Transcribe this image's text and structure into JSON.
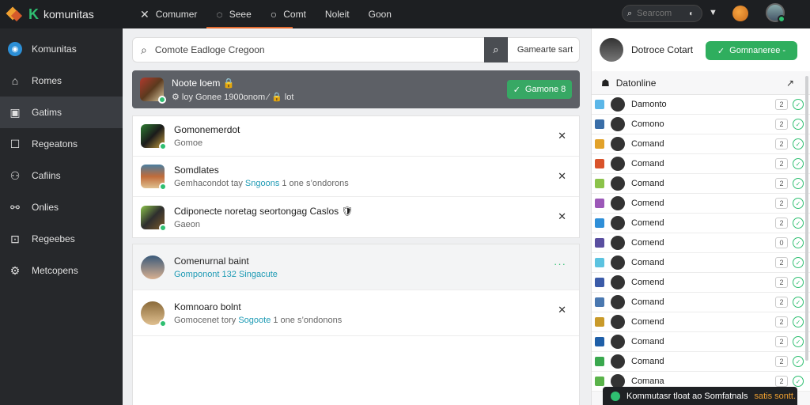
{
  "brand": {
    "name": "komunitas",
    "logo_letter": "K"
  },
  "topnav": [
    {
      "icon": "✕",
      "label": "Comumer"
    },
    {
      "icon": "◌",
      "label": "Seee"
    },
    {
      "icon": "○",
      "label": "Comt"
    },
    {
      "icon": "",
      "label": "Noleit"
    },
    {
      "icon": "",
      "label": "Goon"
    }
  ],
  "top_search": {
    "placeholder": "Searcom"
  },
  "sidebar": [
    {
      "label": "Komunitas",
      "icon": "◉"
    },
    {
      "label": "Romes",
      "icon": "⌂"
    },
    {
      "label": "Gatims",
      "icon": "▣"
    },
    {
      "label": "Regeatons",
      "icon": "☐"
    },
    {
      "label": "Cafiins",
      "icon": "⚇"
    },
    {
      "label": "Onlies",
      "icon": "⚯"
    },
    {
      "label": "Regeebes",
      "icon": "⊡"
    },
    {
      "label": "Metcopens",
      "icon": "⚙"
    }
  ],
  "main": {
    "search": {
      "value": "Comote Eadloge Cregoon",
      "extra": "Gamearte sart"
    },
    "feature": {
      "title": "Noote loem 🔒",
      "sub": "⚙ loy Gonee 1900onom ⁄ 🔒 lot",
      "button": "Gamone 8"
    },
    "rows": [
      {
        "title": "Gomonemerdot",
        "sub": "Gomoe",
        "accent": "",
        "after": ""
      },
      {
        "title": "Somdlates",
        "sub": "Gemhacondot tay ",
        "accent": "Sngoons",
        "after": " 1 one s’ondorons"
      },
      {
        "title": "Cdiponecte noretag seortongag Caslos 🛡",
        "sub": "Gaeon",
        "accent": "",
        "after": ""
      }
    ],
    "rows2": [
      {
        "title": "Comenurnal baint",
        "sub": "",
        "accent": "Gomponont 132 Singacute",
        "after": ""
      },
      {
        "title": "Komnoaro bolnt",
        "sub": "Gomocenet tory ",
        "accent": "Sogoote",
        "after": " 1 one s’ondonons"
      }
    ],
    "more_icon": "···"
  },
  "right": {
    "user_name": "Dotroce Cotart",
    "button": "Gomnaneree -",
    "online_title": "Datonline",
    "users": [
      {
        "name": "Damonto",
        "count": "2",
        "mini": "#5cb7e8"
      },
      {
        "name": "Comono",
        "count": "2",
        "mini": "#3a6ea8"
      },
      {
        "name": "Comand",
        "count": "2",
        "mini": "#e2a22a"
      },
      {
        "name": "Comand",
        "count": "2",
        "mini": "#d9532b"
      },
      {
        "name": "Comand",
        "count": "2",
        "mini": "#8bc34a"
      },
      {
        "name": "Comend",
        "count": "2",
        "mini": "#9c58b8"
      },
      {
        "name": "Comend",
        "count": "2",
        "mini": "#2f8fd8"
      },
      {
        "name": "Comend",
        "count": "0",
        "mini": "#5a4fa0"
      },
      {
        "name": "Comand",
        "count": "2",
        "mini": "#5cc3e0"
      },
      {
        "name": "Comend",
        "count": "2",
        "mini": "#3b5ba8"
      },
      {
        "name": "Comand",
        "count": "2",
        "mini": "#4a78b0"
      },
      {
        "name": "Comend",
        "count": "2",
        "mini": "#c99a2a"
      },
      {
        "name": "Comand",
        "count": "2",
        "mini": "#1f5fa8"
      },
      {
        "name": "Comand",
        "count": "2",
        "mini": "#3aa84e"
      },
      {
        "name": "Comana",
        "count": "2",
        "mini": "#5ab34a"
      }
    ]
  },
  "toast": {
    "text": "Kommutasr tloat ao Somfatnals",
    "highlight": "satis sontt."
  }
}
